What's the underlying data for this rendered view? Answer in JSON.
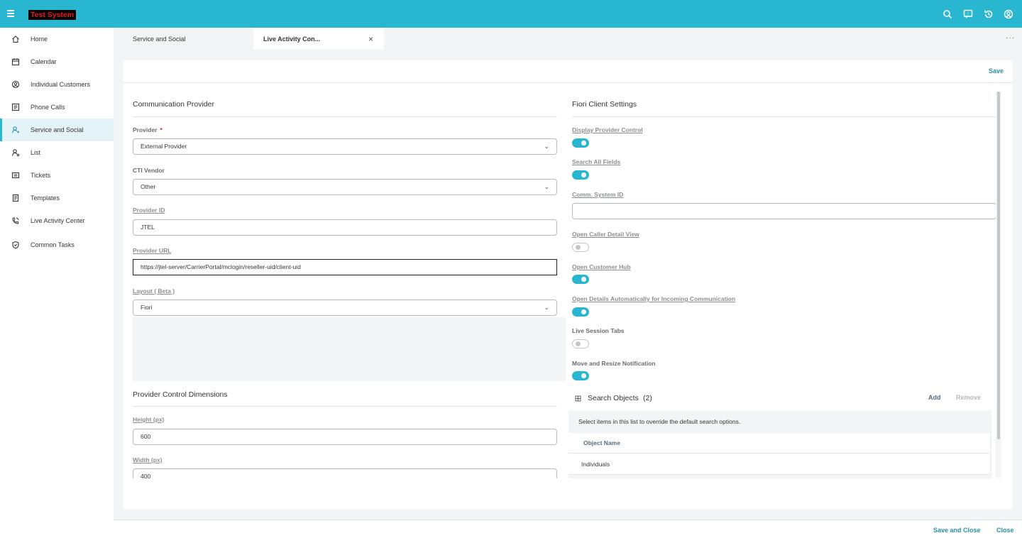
{
  "shell": {
    "brand": "Test System"
  },
  "sidebar": {
    "items": [
      {
        "label": "Home",
        "icon": "home-icon"
      },
      {
        "label": "Calendar",
        "icon": "calendar-icon"
      },
      {
        "label": "Individual Customers",
        "icon": "customer-icon"
      },
      {
        "label": "Phone Calls",
        "icon": "phone-calls-icon"
      },
      {
        "label": "Service and Social",
        "icon": "service-icon"
      },
      {
        "label": "List",
        "icon": "list-icon"
      },
      {
        "label": "Tickets",
        "icon": "tickets-icon"
      },
      {
        "label": "Templates",
        "icon": "templates-icon"
      },
      {
        "label": "Live Activity Center",
        "icon": "live-activity-icon"
      },
      {
        "label": "Common Tasks",
        "icon": "tasks-icon"
      }
    ]
  },
  "tabs": {
    "tab1": "Service and Social",
    "tab2": "Live Activity Con...",
    "more": "···"
  },
  "toolbar": {
    "save": "Save"
  },
  "left": {
    "section_title": "Communication Provider",
    "provider_label": "Provider",
    "provider_required": "*",
    "provider_value": "External Provider",
    "cti_label": "CTI Vendor",
    "cti_value": "Other",
    "provider_id_label": "Provider ID",
    "provider_id_value": "JTEL",
    "provider_url_label": "Provider URL",
    "provider_url_value": "https://jtel-server/CarrierPortal/mclogin/reseller-uid/client-uid",
    "layout_label": "Layout ( Beta )",
    "layout_value": "Fiori",
    "dims_title": "Provider Control Dimensions",
    "height_label": "Height (px)",
    "height_value": "600",
    "width_label": "Width (px)",
    "width_value": "400"
  },
  "right": {
    "section_title": "Fiori Client Settings",
    "display_provider_control": "Display Provider Control",
    "search_all_fields": "Search All Fields",
    "comm_system_id": "Comm. System ID",
    "comm_system_id_value": "",
    "open_caller_detail": "Open Caller Detail View",
    "open_customer_hub": "Open Customer Hub",
    "open_details_auto": "Open Details Automatically for Incoming Communication",
    "live_session_tabs": "Live Session Tabs",
    "move_resize": "Move and Resize Notification",
    "toggles": {
      "display_provider_control": true,
      "search_all_fields": true,
      "open_caller_detail": false,
      "open_customer_hub": true,
      "open_details_auto": true,
      "live_session_tabs": false,
      "move_resize": true
    }
  },
  "search_objects": {
    "title": "Search Objects",
    "count": "(2)",
    "add": "Add",
    "remove": "Remove",
    "hint": "Select items in this list to override the default search options.",
    "column": "Object Name",
    "rows": [
      "Individuals"
    ]
  },
  "footer": {
    "save_close": "Save and Close",
    "close": "Close"
  }
}
